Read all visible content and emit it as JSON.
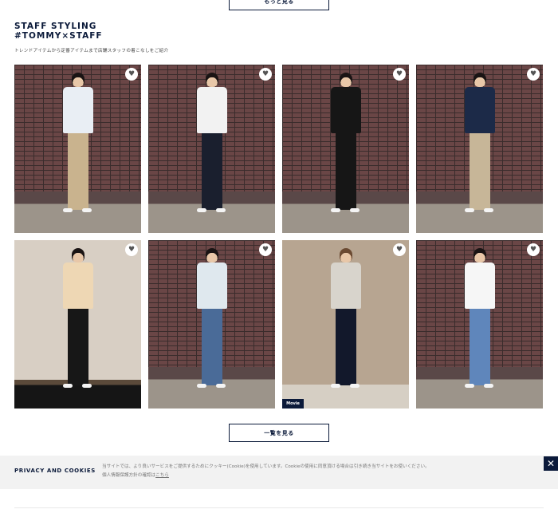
{
  "top_button": {
    "label": "もっと見る"
  },
  "section": {
    "title_line1": "STAFF STYLING",
    "title_line2": "#TOMMY×STAFF",
    "subtitle": "トレンドアイテムから定番アイテムまで店舗スタッフの着こなしをご紹介"
  },
  "favorite_icon": "heart-icon",
  "cards": [
    {
      "background": "brick",
      "top": "#e9eef4",
      "legs": "#c9b38e",
      "hair": "#1a1414",
      "movie": false
    },
    {
      "background": "brick",
      "top": "#f2f2f2",
      "legs": "#1a1f2e",
      "hair": "#1a1414",
      "movie": false
    },
    {
      "background": "brick",
      "top": "#161616",
      "legs": "#161616",
      "hair": "#1a1414",
      "movie": false
    },
    {
      "background": "brick",
      "top": "#1c2a48",
      "legs": "#c7b698",
      "hair": "#1a1414",
      "movie": false
    },
    {
      "background": "beige",
      "top": "#eed7b4",
      "legs": "#171717",
      "hair": "#1a1414",
      "movie": false
    },
    {
      "background": "brick",
      "top": "#dfe8ee",
      "legs": "#4a6b98",
      "hair": "#1a1414",
      "movie": false
    },
    {
      "background": "tan",
      "top": "#d8d4cc",
      "legs": "#12182b",
      "hair": "#6b4a32",
      "movie": true
    },
    {
      "background": "brick",
      "top": "#f6f6f6",
      "legs": "#5f86bb",
      "hair": "#1a1414",
      "movie": false
    }
  ],
  "movie_badge": "Movie",
  "list_button": {
    "label": "一覧を見る"
  },
  "cookie": {
    "title": "PRIVACY AND COOKIES",
    "text_line1": "当サイトでは、より良いサービスをご提供するためにクッキー(Cookie)を使用しています。Cookieの使用に同意頂ける場合は引き続き当サイトをお使いください。",
    "text_line2_prefix": "個人情報保護方針の確認は",
    "link": "こちら",
    "close_symbol": "✕"
  }
}
